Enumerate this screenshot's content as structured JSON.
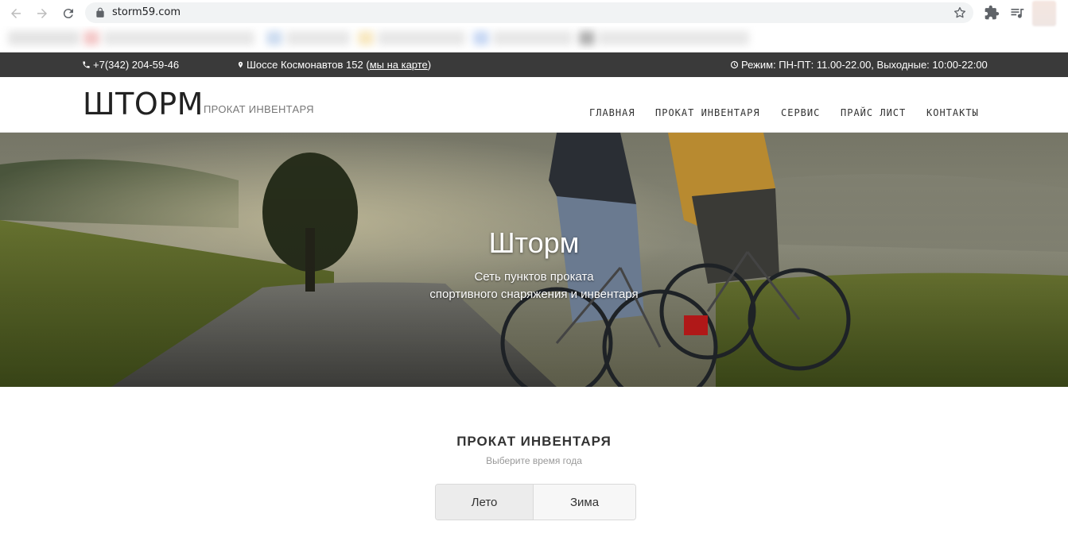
{
  "browser": {
    "url": "storm59.com"
  },
  "topbar": {
    "phone": "+7(342) 204-59-46",
    "address": "Шоссе Космонавтов 152 (",
    "map_link": "мы на карте",
    "address_close": ")",
    "hours": "Режим: ПН-ПТ: 11.00-22.00, Выходные: 10:00-22:00"
  },
  "header": {
    "logo": "ШТОРМ",
    "tagline": "ПРОКАТ ИНВЕНТАРЯ",
    "menu": [
      "ГЛАВНАЯ",
      "ПРОКАТ ИНВЕНТАРЯ",
      "СЕРВИС",
      "ПРАЙС ЛИСТ",
      "КОНТАКТЫ"
    ]
  },
  "hero": {
    "title": "Шторм",
    "subtitle_line1": "Сеть пунктов проката",
    "subtitle_line2": "спортивного снаряжения и инвентаря"
  },
  "section": {
    "title": "ПРОКАТ ИНВЕНТАРЯ",
    "subtitle": "Выберите время года",
    "tabs": [
      "Лето",
      "Зима"
    ],
    "active_tab": "Лето"
  },
  "icons": {
    "back": "arrow-left-icon",
    "forward": "arrow-right-icon",
    "reload": "reload-icon",
    "lock": "lock-icon",
    "star": "star-icon",
    "extensions": "puzzle-icon",
    "media": "playlist-icon",
    "phone": "phone-icon",
    "pin": "map-pin-icon",
    "clock": "clock-icon"
  }
}
